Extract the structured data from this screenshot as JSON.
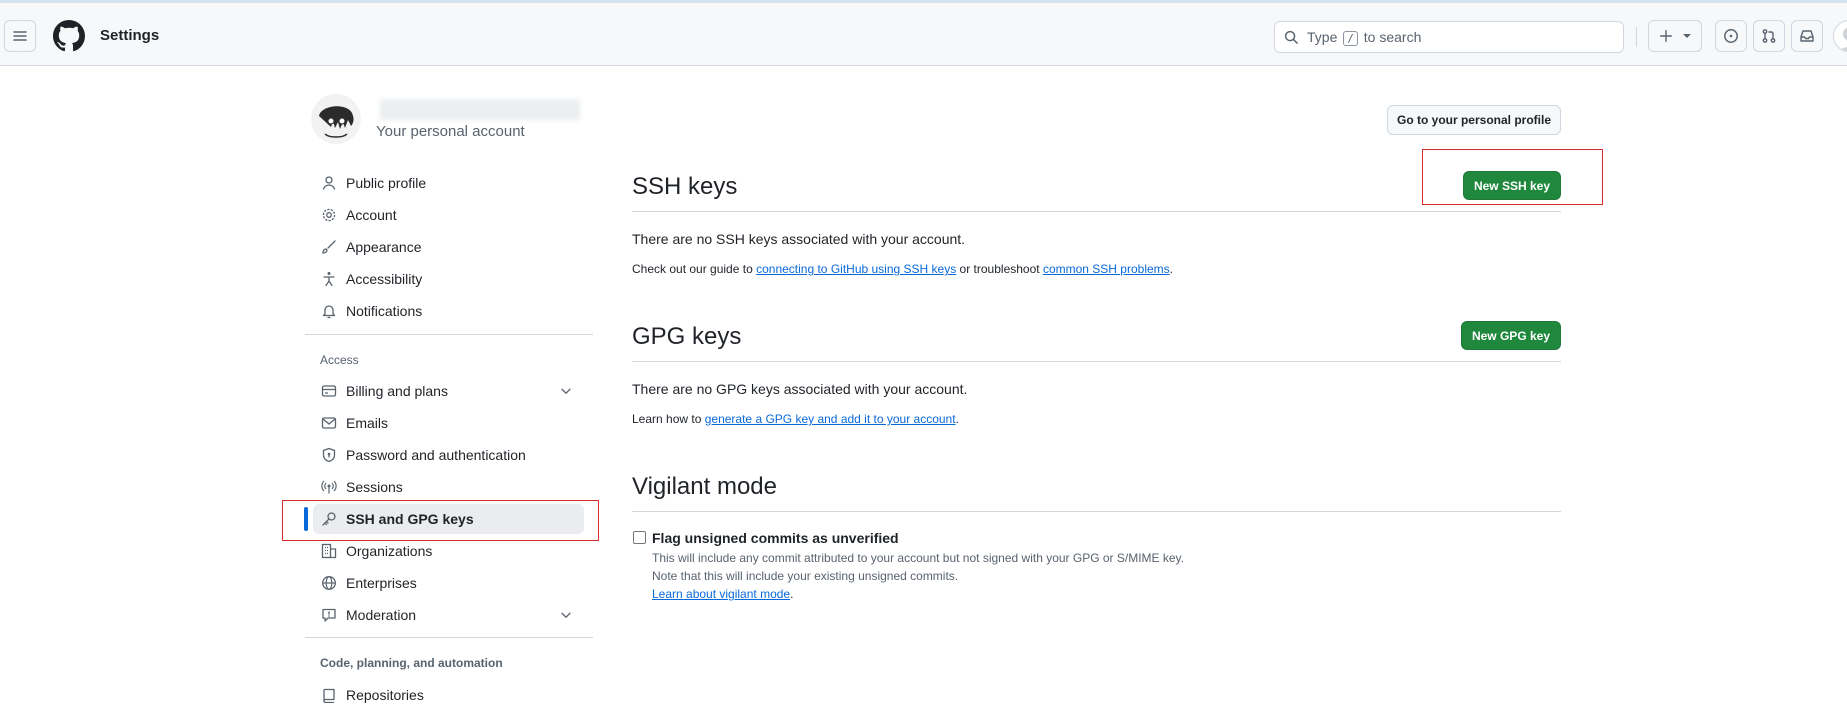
{
  "header": {
    "title": "Settings",
    "search": {
      "before": "Type",
      "key": "/",
      "after": "to search"
    }
  },
  "account": {
    "name": "",
    "subtitle": "Your personal account",
    "go_profile_label": "Go to your personal profile"
  },
  "sidebar": {
    "items": [
      {
        "label": "Public profile",
        "icon": "person-icon"
      },
      {
        "label": "Account",
        "icon": "gear-icon"
      },
      {
        "label": "Appearance",
        "icon": "paintbrush-icon"
      },
      {
        "label": "Accessibility",
        "icon": "accessibility-icon"
      },
      {
        "label": "Notifications",
        "icon": "bell-icon"
      }
    ],
    "access_heading": "Access",
    "access_items": [
      {
        "label": "Billing and plans",
        "icon": "credit-card-icon"
      },
      {
        "label": "Emails",
        "icon": "mail-icon"
      },
      {
        "label": "Password and authentication",
        "icon": "shield-lock-icon"
      },
      {
        "label": "Sessions",
        "icon": "broadcast-icon"
      },
      {
        "label": "SSH and GPG keys",
        "icon": "key-icon"
      },
      {
        "label": "Organizations",
        "icon": "organization-icon"
      },
      {
        "label": "Enterprises",
        "icon": "globe-icon"
      },
      {
        "label": "Moderation",
        "icon": "report-icon"
      }
    ],
    "code_heading": "Code, planning, and automation",
    "code_items": [
      {
        "label": "Repositories",
        "icon": "repo-icon"
      }
    ]
  },
  "ssh": {
    "title": "SSH keys",
    "button": "New SSH key",
    "empty": "There are no SSH keys associated with your account.",
    "guide_prefix": "Check out our guide to",
    "guide_link": "connecting to GitHub using SSH keys",
    "guide_mid": "or troubleshoot",
    "guide_link2": "common SSH problems",
    "guide_end": "."
  },
  "gpg": {
    "title": "GPG keys",
    "button": "New GPG key",
    "empty": "There are no GPG keys associated with your account.",
    "learn_prefix": "Learn how to",
    "learn_link": "generate a GPG key and add it to your account",
    "learn_end": "."
  },
  "vigilant": {
    "title": "Vigilant mode",
    "checkbox_label": "Flag unsigned commits as unverified",
    "desc1": "This will include any commit attributed to your account but not signed with your GPG or S/MIME key.",
    "desc2": "Note that this will include your existing unsigned commits.",
    "learn_link": "Learn about vigilant mode",
    "learn_end": "."
  },
  "colors": {
    "accent": "#0969da",
    "primary_button": "#1f883d",
    "highlight_box": "#d62b2b"
  }
}
